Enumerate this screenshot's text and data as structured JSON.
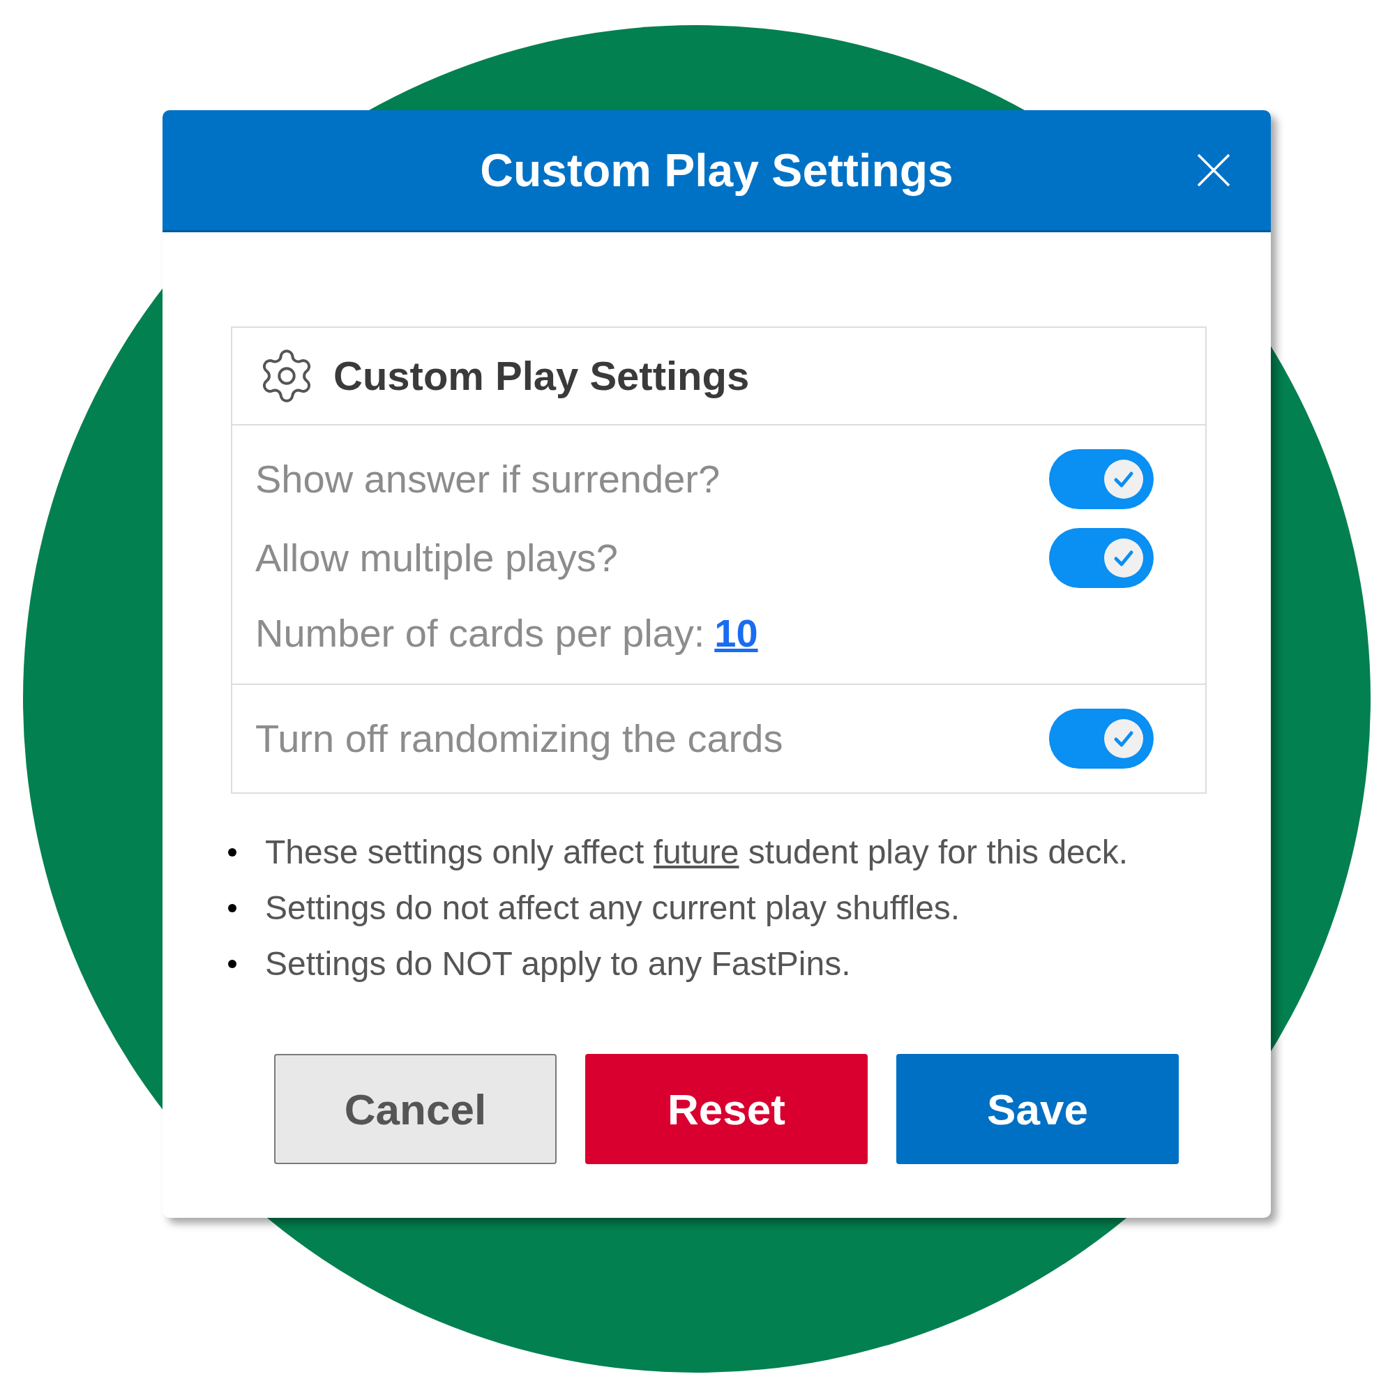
{
  "dialog": {
    "title": "Custom Play Settings"
  },
  "panel": {
    "heading": "Custom Play Settings",
    "sections": [
      {
        "rows": [
          {
            "kind": "toggle",
            "label": "Show answer if surrender?",
            "on": true
          },
          {
            "kind": "toggle",
            "label": "Allow multiple plays?",
            "on": true
          },
          {
            "kind": "value",
            "label": "Number of cards per play:",
            "value": "10"
          }
        ]
      },
      {
        "rows": [
          {
            "kind": "toggle",
            "label": "Turn off randomizing the cards",
            "on": true
          }
        ]
      }
    ]
  },
  "notes": [
    {
      "segments": [
        {
          "text": "These settings only affect ",
          "underline": false
        },
        {
          "text": "future",
          "underline": true
        },
        {
          "text": " student play for this deck.",
          "underline": false
        }
      ]
    },
    {
      "segments": [
        {
          "text": "Settings do not affect any current play shuffles.",
          "underline": false
        }
      ]
    },
    {
      "segments": [
        {
          "text": "Settings do NOT apply to any FastPins.",
          "underline": false
        }
      ]
    }
  ],
  "buttons": [
    {
      "label": "Cancel",
      "kind": "secondary"
    },
    {
      "label": "Reset",
      "kind": "danger"
    },
    {
      "label": "Save",
      "kind": "primary"
    }
  ]
}
